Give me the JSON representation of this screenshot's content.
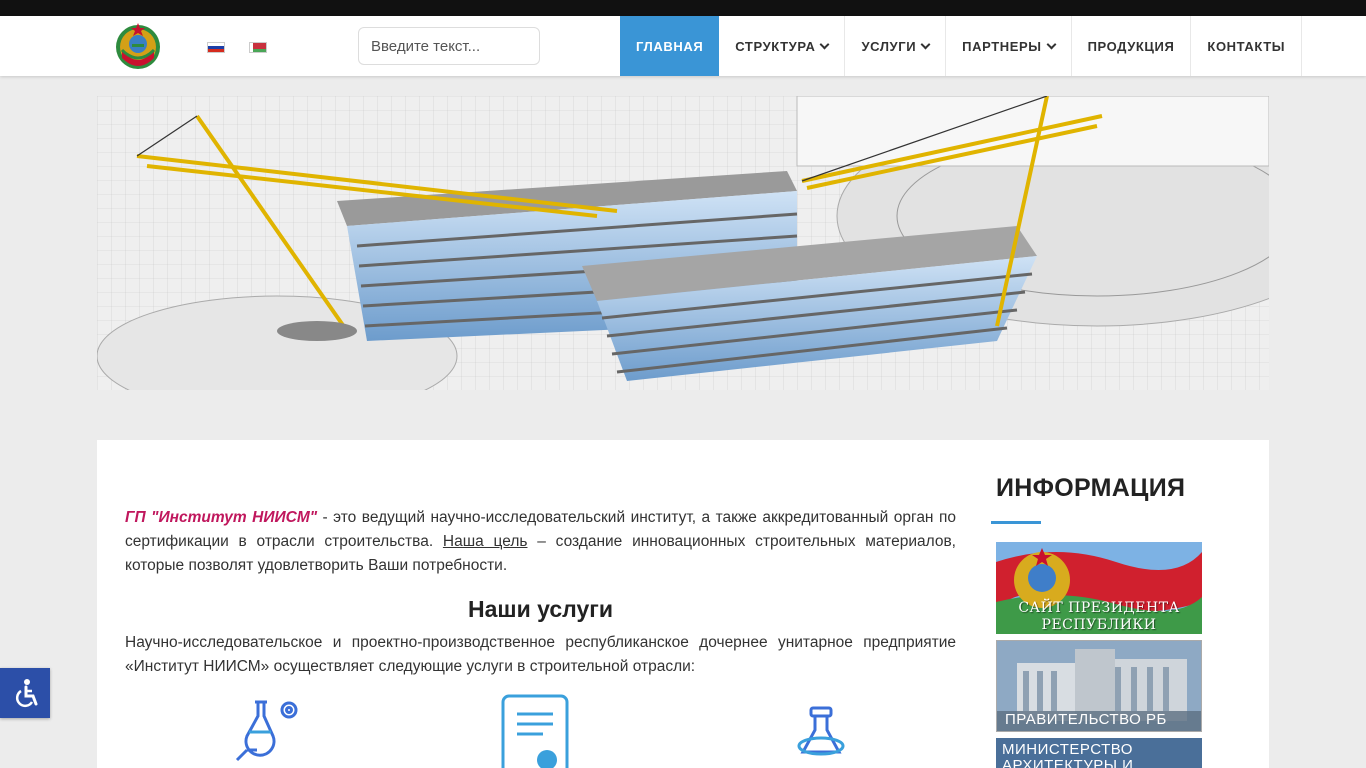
{
  "header": {
    "search": {
      "placeholder": "Введите текст...",
      "value": ""
    },
    "languages": [
      "ru",
      "by"
    ],
    "nav": [
      {
        "label": "ГЛАВНАЯ",
        "active": true,
        "dropdown": false
      },
      {
        "label": "СТРУКТУРА",
        "active": false,
        "dropdown": true
      },
      {
        "label": "УСЛУГИ",
        "active": false,
        "dropdown": true
      },
      {
        "label": "ПАРТНЕРЫ",
        "active": false,
        "dropdown": true
      },
      {
        "label": "ПРОДУКЦИЯ",
        "active": false,
        "dropdown": false
      },
      {
        "label": "КОНТАКТЫ",
        "active": false,
        "dropdown": false
      }
    ]
  },
  "main": {
    "intro": {
      "org": "ГП \"Институт НИИСМ\"",
      "part1": " - это ведущий научно-исследовательский институт, а также аккредитованный орган по сертификации в отрасли строительства. ",
      "goal": "Наша цель",
      "part2": " – создание инновационных строительных материалов, которые позволят удовлетворить Ваши потребности."
    },
    "services_title": "Наши услуги",
    "services_text": "Научно-исследовательское и проектно-производственное республиканское дочернее унитарное предприятие «Институт НИИСМ» осуществляет следующие услуги в строительной отрасли:"
  },
  "sidebar": {
    "title": "ИНФОРМАЦИЯ",
    "banners": [
      {
        "line1": "САЙТ ПРЕЗИДЕНТА",
        "line2": "РЕСПУБЛИКИ БЕЛАРУСЬ"
      },
      {
        "label": "ПРАВИТЕЛЬСТВО РБ"
      },
      {
        "line1": "МИНИСТЕРСТВО",
        "line2": "АРХИТЕКТУРЫ И"
      }
    ]
  },
  "colors": {
    "accent": "#3a95d6",
    "org_highlight": "#c0175d",
    "accessibility": "#2c4fa8"
  },
  "icons": [
    "wheelchair-icon",
    "flask-gear-icon",
    "certificate-icon",
    "lab-flask-icon"
  ]
}
